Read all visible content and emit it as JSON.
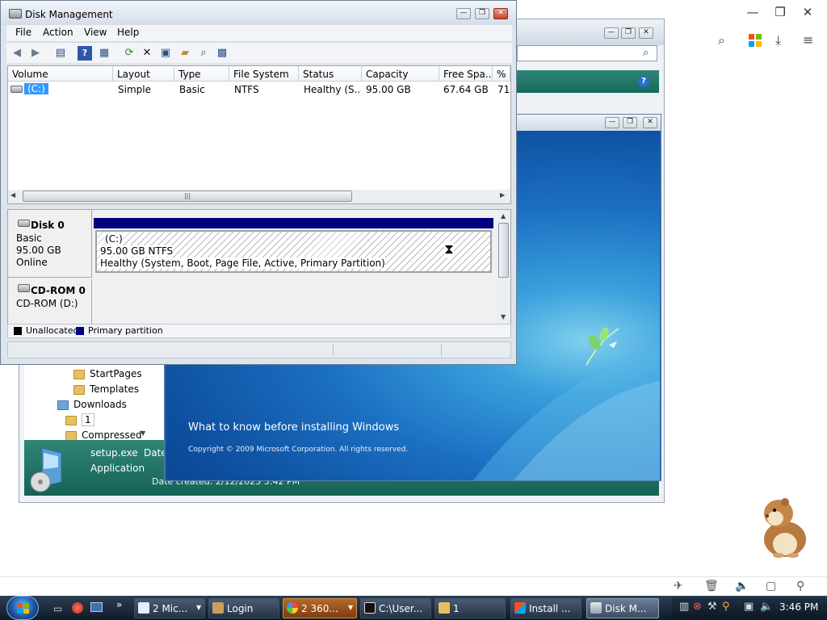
{
  "browser": {
    "controls": {
      "minimize": "—",
      "restore": "❐",
      "close": "✕"
    },
    "toolbar_icons": [
      "search-icon",
      "windows-logo-icon",
      "download-icon",
      "menu-icon"
    ]
  },
  "explorer": {
    "tree": [
      {
        "label": "StartPages"
      },
      {
        "label": "Templates"
      },
      {
        "label": "Downloads"
      },
      {
        "label": "1"
      },
      {
        "label": "Compressed"
      }
    ],
    "details": {
      "file_name": "setup.exe",
      "file_type": "Application",
      "date_label": "Date",
      "date_created": "Date created: 2/12/2025 3:42 PM"
    }
  },
  "setup": {
    "link": "What to know before installing Windows",
    "copyright": "Copyright © 2009 Microsoft Corporation. All rights reserved."
  },
  "disk_management": {
    "title": "Disk Management",
    "menu": [
      "File",
      "Action",
      "View",
      "Help"
    ],
    "columns": [
      "Volume",
      "Layout",
      "Type",
      "File System",
      "Status",
      "Capacity",
      "Free Spa...",
      "% F"
    ],
    "rows": [
      {
        "volume": "(C:)",
        "layout": "Simple",
        "type": "Basic",
        "fs": "NTFS",
        "status": "Healthy (S...",
        "capacity": "95.00 GB",
        "free": "67.64 GB",
        "pct": "71"
      }
    ],
    "disks": [
      {
        "name": "Disk 0",
        "kind": "Basic",
        "size": "95.00 GB",
        "state": "Online",
        "partition": {
          "label": "(C:)",
          "size": "95.00 GB NTFS",
          "status": "Healthy (System, Boot, Page File, Active, Primary Partition)"
        }
      },
      {
        "name": "CD-ROM 0",
        "kind": "CD-ROM (D:)"
      }
    ],
    "legend": {
      "unallocated": "Unallocated",
      "primary": "Primary partition"
    }
  },
  "taskbar": {
    "items": [
      {
        "label": "2 Mic..."
      },
      {
        "label": "Login"
      },
      {
        "label": "2 360..."
      },
      {
        "label": "C:\\User..."
      },
      {
        "label": "1"
      },
      {
        "label": "Install ..."
      },
      {
        "label": "Disk M..."
      }
    ],
    "time": "3:46 PM"
  },
  "colors": {
    "primary_partition": "#000080",
    "taskbar": "#1b2a3a",
    "setup_blue": "#1b6fc2"
  }
}
